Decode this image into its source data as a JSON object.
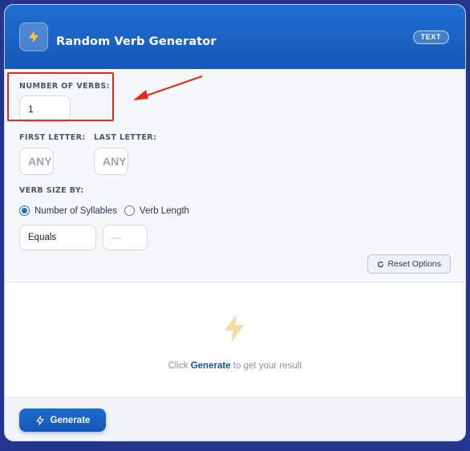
{
  "header": {
    "title": "Random Verb Generator",
    "badge": "TEXT",
    "logo_icon": "bolt-icon"
  },
  "form": {
    "num_verbs_label": "NUMBER OF VERBS:",
    "num_verbs_value": "1",
    "first_letter_label": "FIRST LETTER:",
    "first_letter_placeholder": "ANY",
    "last_letter_label": "LAST LETTER:",
    "last_letter_placeholder": "ANY",
    "verb_size_label": "VERB SIZE BY:",
    "radio_options": [
      {
        "label": "Number of Syllables",
        "checked": true
      },
      {
        "label": "Verb Length",
        "checked": false
      }
    ],
    "comparison_value": "Equals",
    "size_value_placeholder": "—",
    "reset_label": "Reset Options",
    "reset_icon": "refresh-icon"
  },
  "results": {
    "hint_prefix": "Click",
    "hint_action": "Generate",
    "hint_suffix": "to get your result"
  },
  "footer": {
    "generate_label": "Generate"
  },
  "colors": {
    "header": "#1a64c6",
    "accent": "#1a6fd1",
    "highlight": "#e52b20",
    "bolt": "#f5c45e"
  }
}
